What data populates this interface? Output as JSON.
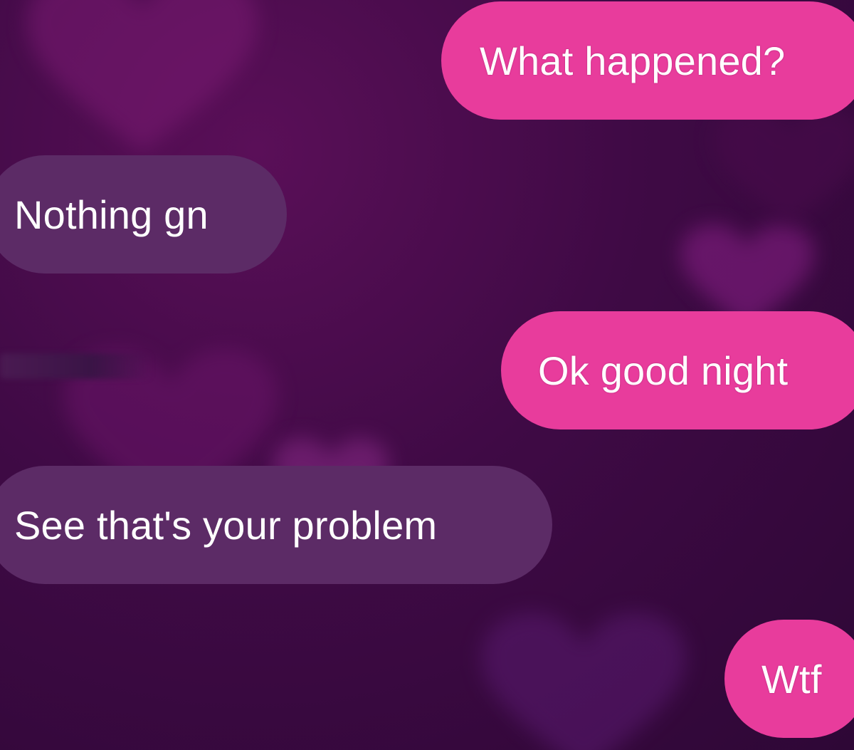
{
  "conversation": {
    "messages": [
      {
        "direction": "sent",
        "text": "What happened?"
      },
      {
        "direction": "received",
        "text": "Nothing gn"
      },
      {
        "direction": "sent",
        "text": "Ok good night"
      },
      {
        "direction": "received",
        "text": "See that's your problem"
      },
      {
        "direction": "sent",
        "text": "Wtf"
      }
    ]
  },
  "colors": {
    "sent_bubble": "#e83c9c",
    "received_bubble": "#5c2b66",
    "background": "#3f0a45",
    "heart_decoration": "#7a1a7a"
  }
}
